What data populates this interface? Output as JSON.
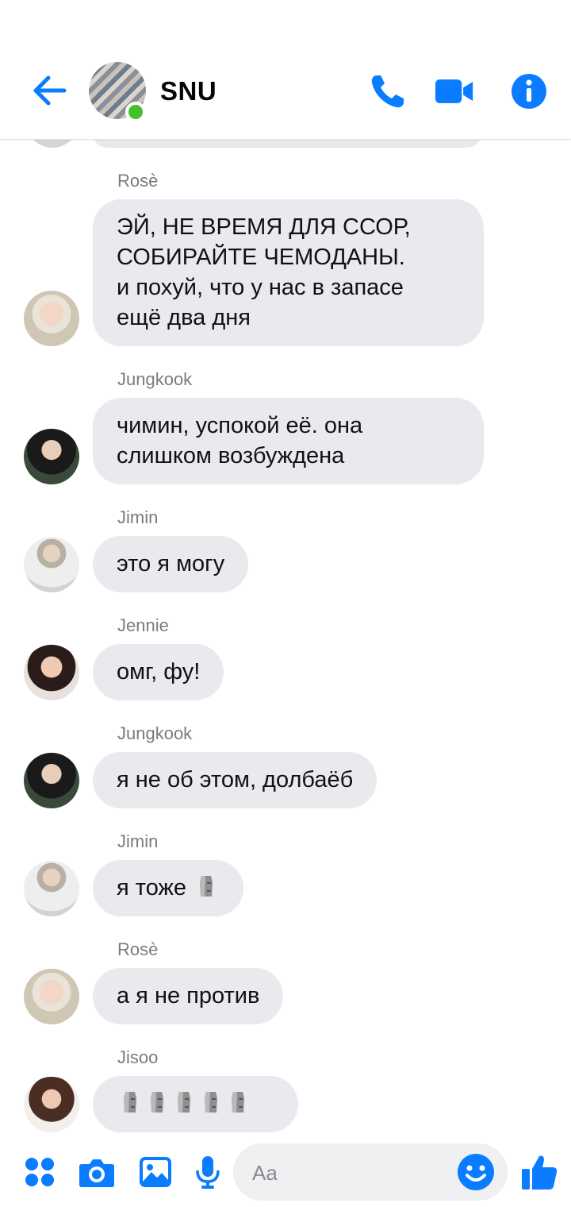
{
  "header": {
    "title": "SNU"
  },
  "messages": [
    {
      "sender": "Rosè",
      "text": [
        "ЭЙ, НЕ ВРЕМЯ ДЛЯ ССОР,",
        "СОБИРАЙТЕ ЧЕМОДАНЫ.",
        "и похуй, что у нас в запасе",
        "ещё два дня"
      ]
    },
    {
      "sender": "Jungkook",
      "text": [
        "чимин, успокой её. она",
        "слишком возбуждена"
      ]
    },
    {
      "sender": "Jimin",
      "text": [
        "это я могу"
      ]
    },
    {
      "sender": "Jennie",
      "text": [
        "омг, фу!"
      ]
    },
    {
      "sender": "Jungkook",
      "text": [
        "я не об этом, долбаёб"
      ]
    },
    {
      "sender": "Jimin",
      "text": [
        "я тоже"
      ]
    },
    {
      "sender": "Rosè",
      "text": [
        "а я не против"
      ]
    },
    {
      "sender": "Jisoo",
      "text": [
        ""
      ]
    }
  ],
  "composer": {
    "placeholder": "Aa"
  },
  "colors": {
    "accent": "#0a7cff",
    "bubble": "#e9e9ee",
    "online": "#42c02e"
  },
  "icons": [
    "back-arrow-icon",
    "phone-icon",
    "video-camera-icon",
    "info-icon",
    "apps-icon",
    "camera-icon",
    "gallery-icon",
    "microphone-icon",
    "emoji-icon",
    "thumbs-up-icon",
    "moai-emoji"
  ]
}
